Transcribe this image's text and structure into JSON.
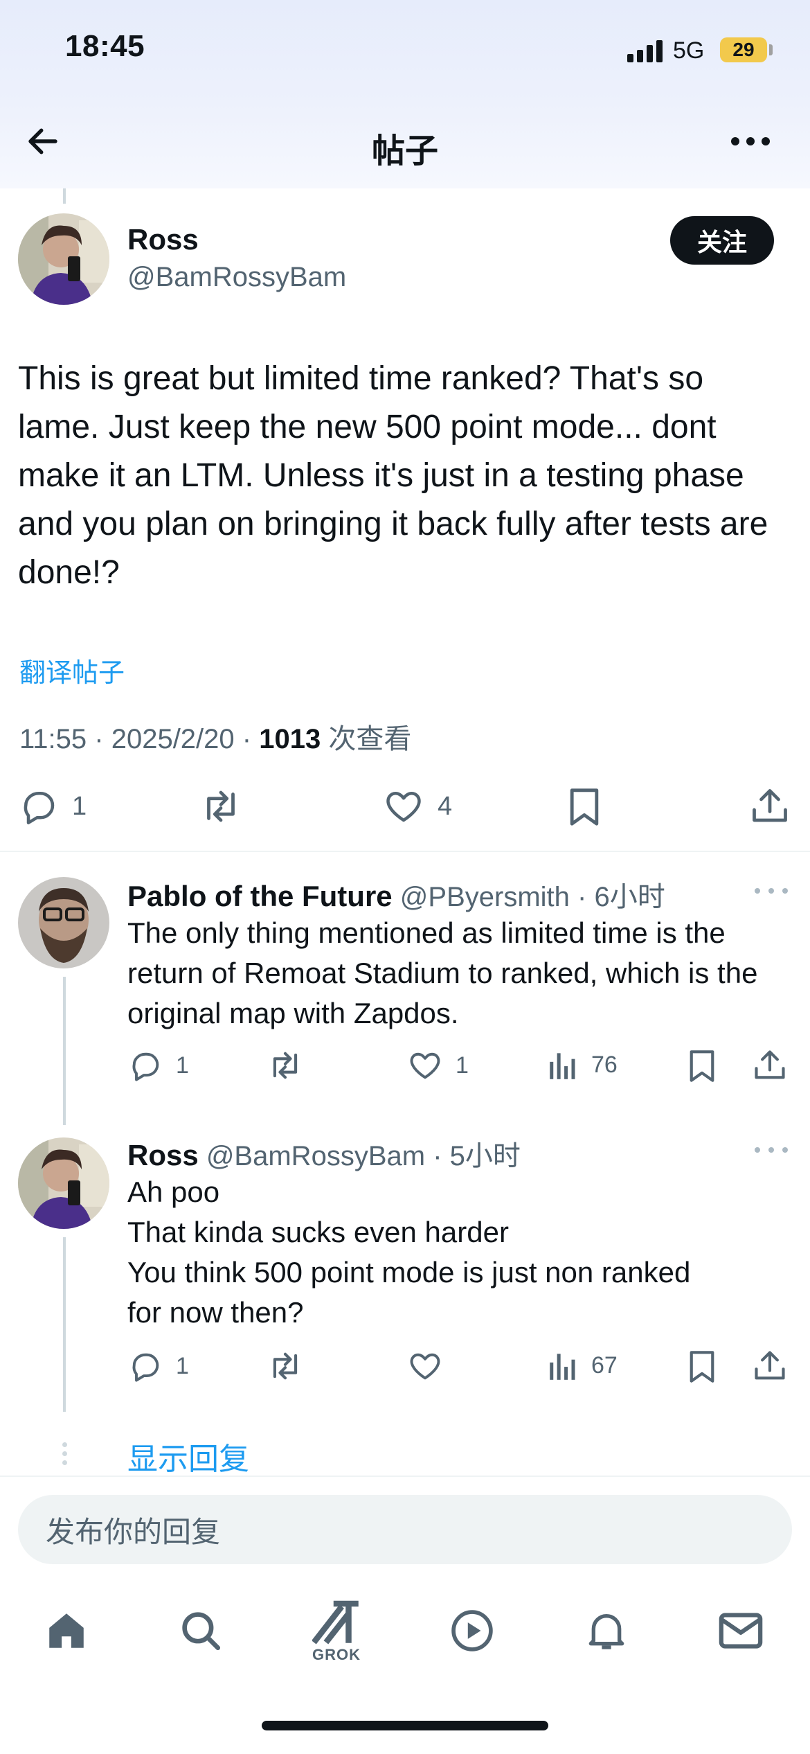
{
  "status_bar": {
    "time": "18:45",
    "network": "5G",
    "battery": "29",
    "battery_color": "#f2c94c"
  },
  "header": {
    "title": "帖子",
    "back_icon": "arrow-left-icon",
    "more_icon": "more-horizontal-icon"
  },
  "main_post": {
    "author_name": "Ross",
    "handle": "@BamRossyBam",
    "follow_label": "关注",
    "text": "This is great but limited time ranked? That's so lame. Just keep the new 500 point mode... dont make it an LTM. Unless it's just in a testing phase and you plan on bringing it back fully after tests are done!?",
    "translate_label": "翻译帖子",
    "time": "11:55",
    "date": "2025/2/20",
    "views": "1013",
    "views_label": "次查看",
    "reply_count": "1",
    "like_count": "4"
  },
  "replies": [
    {
      "author_name": "Pablo of the Future",
      "handle": "@PByersmith",
      "age": "6小时",
      "text": "The only thing mentioned as limited time is the return of Remoat Stadium to ranked, which is the original map with Zapdos.",
      "reply_count": "1",
      "like_count": "1",
      "views": "76"
    },
    {
      "author_name": "Ross",
      "handle": "@BamRossyBam",
      "age": "5小时",
      "text_lines": [
        "Ah poo",
        "That kinda sucks even harder",
        "You think 500 point mode is just non ranked",
        "for now then?"
      ],
      "reply_count": "1",
      "views": "67"
    }
  ],
  "show_replies_label": "显示回复",
  "reply_placeholder": "发布你的回复",
  "tab_bar": {
    "grok_label": "GROK",
    "icons": [
      "home-icon",
      "search-icon",
      "grok-icon",
      "play-icon",
      "bell-icon",
      "mail-icon"
    ]
  },
  "colors": {
    "accent": "#1d9bf0",
    "text": "#0f1419",
    "secondary": "#536471"
  }
}
